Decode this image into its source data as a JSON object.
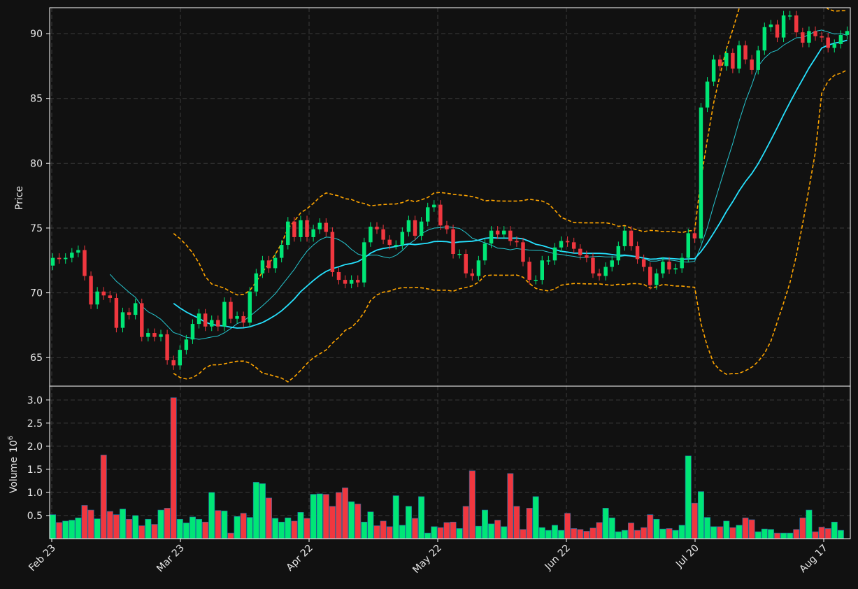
{
  "chart_data": {
    "type": "candlestick",
    "colors": {
      "background": "#111111",
      "up": "#00e676",
      "down": "#f0373f",
      "ma_fast": "#26c6cf",
      "ma_slow": "#26e2ff",
      "band": "#ffa500",
      "grid": "#3a3a3a",
      "spine": "#ffffff",
      "text": "#e8e8e8"
    },
    "grid": true,
    "price_panel": {
      "ylabel": "Price",
      "ylim": [
        62.8,
        92.0
      ],
      "yticks": [
        65,
        70,
        75,
        80,
        85,
        90
      ]
    },
    "volume_panel": {
      "ylabel": "Volume",
      "ylabel_exponent": "10",
      "ylabel_power": "6",
      "ylim": [
        0,
        3.3
      ],
      "yticks": [
        0.5,
        1.0,
        1.5,
        2.0,
        2.5,
        3.0
      ],
      "ytick_labels": [
        "0.5",
        "1.0",
        "1.5",
        "2.0",
        "2.5",
        "3.0"
      ]
    },
    "xtick_labels": [
      "Feb 23",
      "Mar 23",
      "Apr 22",
      "May 22",
      "Jun 22",
      "Jul 20",
      "Aug 17"
    ],
    "xtick_index": [
      0,
      20,
      40,
      60,
      80,
      100,
      120
    ],
    "closes": [
      72.7,
      72.6,
      72.7,
      73.1,
      73.3,
      71.3,
      69.1,
      70.1,
      69.8,
      69.6,
      67.3,
      68.5,
      68.3,
      69.2,
      66.6,
      66.9,
      66.6,
      66.8,
      64.8,
      64.4,
      65.6,
      66.4,
      67.6,
      68.4,
      67.4,
      67.9,
      67.4,
      69.3,
      68.0,
      68.2,
      67.7,
      70.1,
      71.5,
      72.5,
      71.9,
      72.7,
      73.7,
      75.5,
      74.3,
      75.6,
      74.3,
      74.9,
      75.4,
      74.7,
      71.6,
      71.0,
      70.7,
      71.0,
      70.8,
      73.9,
      75.1,
      74.9,
      74.1,
      73.7,
      73.7,
      74.7,
      75.6,
      74.4,
      75.5,
      76.6,
      76.8,
      75.2,
      74.9,
      73.0,
      73.0,
      71.5,
      71.3,
      72.5,
      73.8,
      74.8,
      74.5,
      74.8,
      74.0,
      73.9,
      72.4,
      71.0,
      71.0,
      72.5,
      72.5,
      73.5,
      74.0,
      73.9,
      73.4,
      72.9,
      72.7,
      71.5,
      71.3,
      72.0,
      72.5,
      73.6,
      74.8,
      73.6,
      72.6,
      72.0,
      70.6,
      71.5,
      72.4,
      71.8,
      71.9,
      72.7,
      74.6,
      74.2,
      84.3,
      86.3,
      88.0,
      87.5,
      88.5,
      87.3,
      89.1,
      88.0,
      87.2,
      88.7,
      90.5,
      90.7,
      89.7,
      91.4,
      91.4,
      90.1,
      89.3,
      90.2,
      89.8,
      89.7,
      88.9,
      89.2,
      89.9,
      90.2
    ],
    "volumes_millions": [
      0.52,
      0.35,
      0.38,
      0.4,
      0.45,
      0.72,
      0.62,
      0.43,
      1.81,
      0.59,
      0.52,
      0.64,
      0.42,
      0.5,
      0.28,
      0.42,
      0.31,
      0.62,
      0.66,
      3.05,
      0.42,
      0.34,
      0.47,
      0.42,
      0.36,
      1.0,
      0.61,
      0.6,
      0.12,
      0.48,
      0.55,
      0.46,
      1.22,
      1.19,
      0.88,
      0.44,
      0.36,
      0.45,
      0.38,
      0.57,
      0.44,
      0.96,
      0.97,
      0.96,
      0.7,
      1.0,
      1.1,
      0.8,
      0.75,
      0.36,
      0.58,
      0.28,
      0.38,
      0.26,
      0.93,
      0.29,
      0.7,
      0.44,
      0.91,
      0.12,
      0.26,
      0.24,
      0.35,
      0.36,
      0.22,
      0.7,
      1.47,
      0.27,
      0.62,
      0.32,
      0.4,
      0.26,
      1.41,
      0.7,
      0.2,
      0.66,
      0.91,
      0.24,
      0.18,
      0.29,
      0.18,
      0.55,
      0.22,
      0.2,
      0.16,
      0.23,
      0.35,
      0.66,
      0.45,
      0.15,
      0.18,
      0.34,
      0.18,
      0.24,
      0.52,
      0.42,
      0.21,
      0.22,
      0.18,
      0.29,
      1.79,
      0.77,
      1.02,
      0.46,
      0.26,
      0.26,
      0.38,
      0.24,
      0.29,
      0.45,
      0.41,
      0.15,
      0.21,
      0.2,
      0.12,
      0.12,
      0.12,
      0.2,
      0.45,
      0.62,
      0.15,
      0.25,
      0.22,
      0.36,
      0.18
    ]
  }
}
